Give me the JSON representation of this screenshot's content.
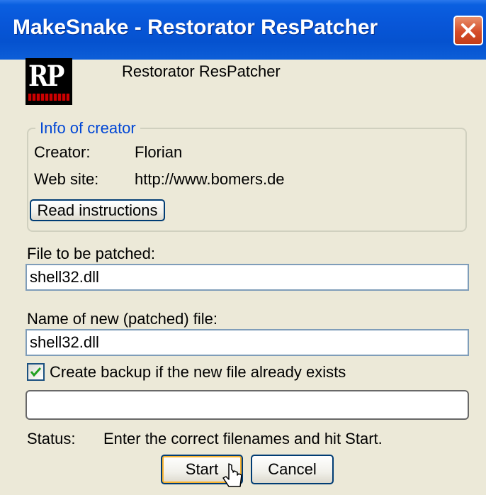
{
  "window": {
    "title": "MakeSnake - Restorator ResPatcher",
    "accent_color": "#0a5fe0",
    "close_icon": "close-icon"
  },
  "header": {
    "logo_text": "RP",
    "app_name": "Restorator ResPatcher"
  },
  "creator_info": {
    "legend": "Info of creator",
    "creator_label": "Creator:",
    "creator_value": "Florian",
    "website_label": "Web site:",
    "website_value": "http://www.bomers.de",
    "read_instructions_label": "Read instructions"
  },
  "form": {
    "file_label": "File to be patched:",
    "file_value": "shell32.dll",
    "new_file_label": "Name of new (patched) file:",
    "new_file_value": "shell32.dll",
    "backup_label": "Create backup if the new file already exists",
    "backup_checked": true
  },
  "status": {
    "label": "Status:",
    "text": "Enter the correct filenames and hit Start.",
    "progress": 0
  },
  "buttons": {
    "start_label": "Start",
    "cancel_label": "Cancel"
  }
}
